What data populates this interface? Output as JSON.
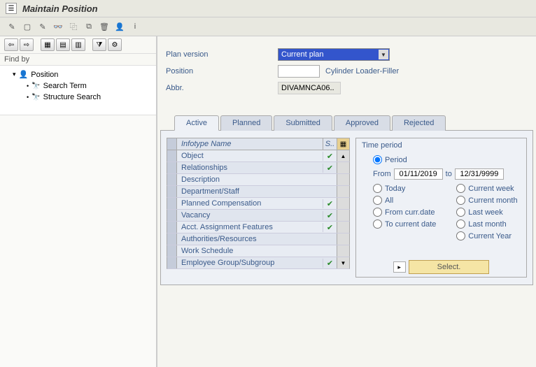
{
  "title": "Maintain Position",
  "toolbar": [
    {
      "name": "wand-icon",
      "glyph": "✎"
    },
    {
      "name": "new-icon",
      "glyph": "▢"
    },
    {
      "name": "edit-icon",
      "glyph": "✎"
    },
    {
      "name": "display-icon",
      "glyph": "👓"
    },
    {
      "name": "copy-icon",
      "glyph": "⿻"
    },
    {
      "name": "delimit-icon",
      "glyph": "⧉"
    },
    {
      "name": "delete-icon",
      "glyph": "🗑"
    },
    {
      "name": "person-icon",
      "glyph": "👤"
    },
    {
      "name": "info-icon",
      "glyph": "i"
    }
  ],
  "nav_toolbar": [
    {
      "name": "back-icon",
      "glyph": "⇦"
    },
    {
      "name": "forward-icon",
      "glyph": "⇨"
    },
    {
      "name": "expand-icon",
      "glyph": "▦"
    },
    {
      "name": "collapse-icon",
      "glyph": "▤"
    },
    {
      "name": "layout-icon",
      "glyph": "▥"
    },
    {
      "name": "filter-icon",
      "glyph": "⧩"
    },
    {
      "name": "settings-icon",
      "glyph": "⚙"
    }
  ],
  "find_by_label": "Find by",
  "tree": {
    "root": "Position",
    "children": [
      "Search Term",
      "Structure Search"
    ]
  },
  "form": {
    "plan_version_label": "Plan version",
    "plan_version_value": "Current plan",
    "position_label": "Position",
    "position_value": "",
    "position_desc": "Cylinder Loader-Filler",
    "abbr_label": "Abbr.",
    "abbr_value": "DIVAMNCA06.."
  },
  "tabs": [
    "Active",
    "Planned",
    "Submitted",
    "Approved",
    "Rejected"
  ],
  "active_tab": 0,
  "infotype": {
    "header_name": "Infotype Name",
    "header_s": "S..",
    "rows": [
      {
        "name": "Object",
        "checked": true
      },
      {
        "name": "Relationships",
        "checked": true
      },
      {
        "name": "Description",
        "checked": false
      },
      {
        "name": "Department/Staff",
        "checked": false
      },
      {
        "name": "Planned Compensation",
        "checked": true
      },
      {
        "name": "Vacancy",
        "checked": true
      },
      {
        "name": "Acct. Assignment Features",
        "checked": true
      },
      {
        "name": "Authorities/Resources",
        "checked": false
      },
      {
        "name": "Work Schedule",
        "checked": false
      },
      {
        "name": "Employee Group/Subgroup",
        "checked": true
      }
    ]
  },
  "time_period": {
    "title": "Time period",
    "period_label": "Period",
    "from_label": "From",
    "from_value": "01/11/2019",
    "to_label": "to",
    "to_value": "12/31/9999",
    "options_left": [
      "Today",
      "All",
      "From curr.date",
      "To current date"
    ],
    "options_right": [
      "Current week",
      "Current month",
      "Last week",
      "Last month",
      "Current Year"
    ],
    "select_label": "Select."
  }
}
